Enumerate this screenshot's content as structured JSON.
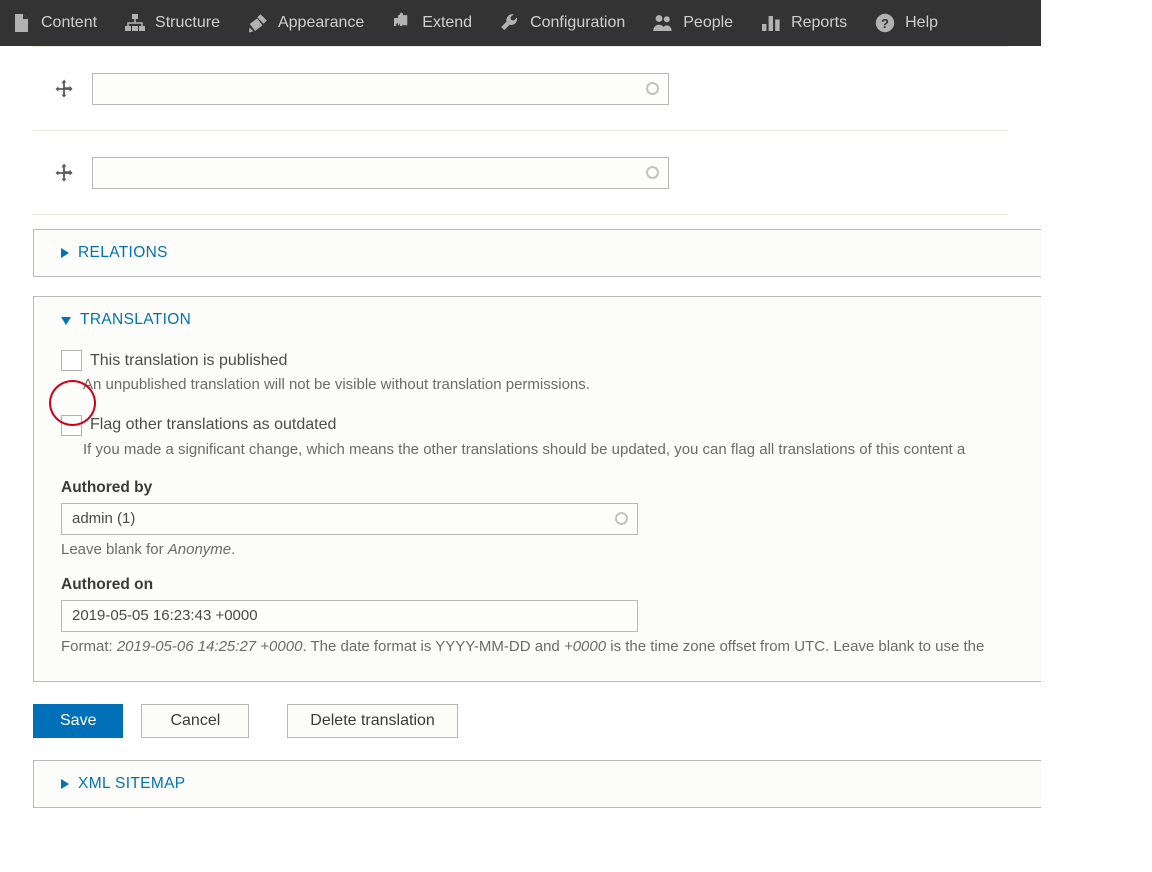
{
  "toolbar": {
    "items": [
      {
        "label": "Content",
        "icon": "page-icon"
      },
      {
        "label": "Structure",
        "icon": "sitemap-icon"
      },
      {
        "label": "Appearance",
        "icon": "paintbrush-icon"
      },
      {
        "label": "Extend",
        "icon": "puzzle-piece-icon"
      },
      {
        "label": "Configuration",
        "icon": "wrench-icon"
      },
      {
        "label": "People",
        "icon": "people-icon"
      },
      {
        "label": "Reports",
        "icon": "bar-chart-icon"
      },
      {
        "label": "Help",
        "icon": "question-mark-icon"
      }
    ]
  },
  "drag_rows": [
    {
      "value": "",
      "placeholder": ""
    },
    {
      "value": "",
      "placeholder": ""
    }
  ],
  "relations": {
    "summary": "RELATIONS",
    "expanded": false
  },
  "translation": {
    "summary": "TRANSLATION",
    "expanded": true,
    "published": {
      "label": "This translation is published",
      "checked": false,
      "description": "An unpublished translation will not be visible without translation permissions."
    },
    "outdated": {
      "label": "Flag other translations as outdated",
      "checked": false,
      "description": "If you made a significant change, which means the other translations should be updated, you can flag all translations of this content a"
    },
    "authored_by": {
      "label": "Authored by",
      "value": "admin (1)",
      "placeholder": "",
      "description_prefix": "Leave blank for ",
      "description_em": "Anonyme",
      "description_suffix": "."
    },
    "authored_on": {
      "label": "Authored on",
      "value": "2019-05-05 16:23:43 +0000",
      "placeholder": "",
      "description_prefix": "Format: ",
      "description_em1": "2019-05-06 14:25:27 +0000",
      "description_mid": ". The date format is YYYY-MM-DD and ",
      "description_em2": "+0000",
      "description_suffix": " is the time zone offset from UTC. Leave blank to use the"
    }
  },
  "actions": {
    "save_label": "Save",
    "cancel_label": "Cancel",
    "delete_label": "Delete translation"
  },
  "xml_sitemap": {
    "summary": "XML SITEMAP",
    "expanded": false
  },
  "colors": {
    "toolbar_bg": "#333333",
    "link_blue": "#0073b6",
    "primary_button": "#0071b8",
    "annotation_red": "#d0021b",
    "panel_bg": "#fcfcfa"
  }
}
